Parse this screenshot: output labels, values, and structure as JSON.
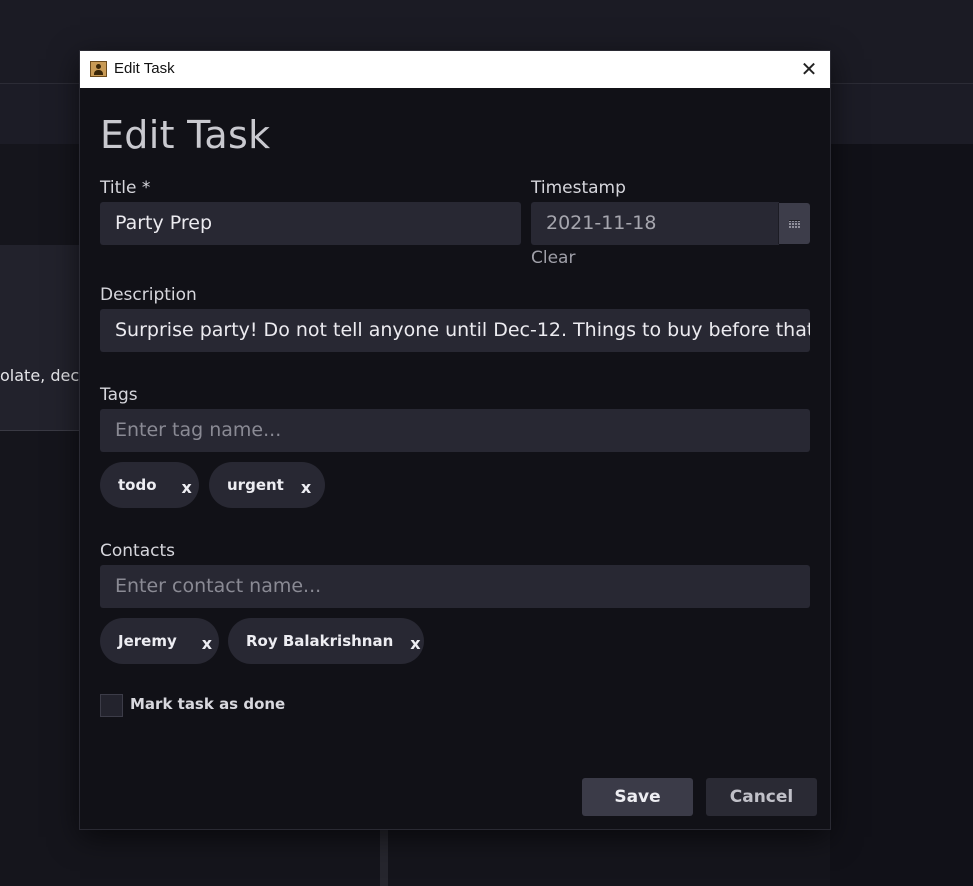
{
  "background": {
    "left_card_text": "olate, deco"
  },
  "window": {
    "title": "Edit Task",
    "close_glyph": "✕"
  },
  "form": {
    "heading": "Edit Task",
    "title_label": "Title *",
    "title_value": "Party Prep",
    "timestamp_label": "Timestamp",
    "timestamp_value": "2021-11-18",
    "clear_label": "Clear",
    "description_label": "Description",
    "description_value": "Surprise party! Do not tell anyone until Dec-12. Things to buy before that: chocolate, deco",
    "tags_label": "Tags",
    "tags_placeholder": "Enter tag name...",
    "tags": [
      {
        "label": "todo",
        "remove": "x"
      },
      {
        "label": "urgent",
        "remove": "x"
      }
    ],
    "contacts_label": "Contacts",
    "contacts_placeholder": "Enter contact name...",
    "contacts": [
      {
        "label": "Jeremy",
        "remove": "x"
      },
      {
        "label": "Roy Balakrishnan",
        "remove": "x"
      }
    ],
    "done_label": "Mark task as done",
    "done_checked": false
  },
  "actions": {
    "save_label": "Save",
    "cancel_label": "Cancel"
  },
  "icons": {
    "app": "contact-card-icon",
    "calendar": "calendar-icon",
    "close": "close-icon"
  },
  "colors": {
    "dialog_bg": "#111117",
    "input_bg": "#282833",
    "chip_bg": "#282833",
    "save_bg": "#3b3b48",
    "cancel_bg": "#2a2a34"
  }
}
